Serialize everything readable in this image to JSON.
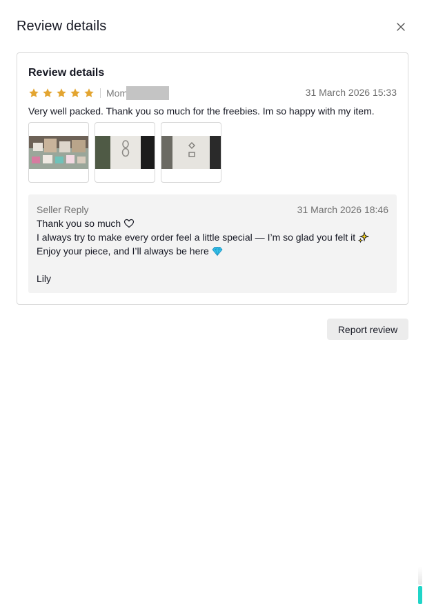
{
  "modal": {
    "title": "Review details",
    "close_icon": "close-icon"
  },
  "review": {
    "card_title": "Review details",
    "rating": 5,
    "max_rating": 5,
    "star_color": "#e3a531",
    "reviewer_name_visible": "Mom",
    "date": "31 March 2026 15:33",
    "text": "Very well packed. Thank you so much for the freebies. Im so happy with my item.",
    "photos": [
      {
        "name": "review-photo-1"
      },
      {
        "name": "review-photo-2"
      },
      {
        "name": "review-photo-3"
      }
    ]
  },
  "seller_reply": {
    "label": "Seller Reply",
    "date": "31 March 2026 18:46",
    "lines": [
      "Thank you so much",
      "I always try to make every order feel a little special — I’m so glad you felt it",
      "Enjoy your piece, and I’ll always be here",
      "",
      "Lily"
    ],
    "emojis": [
      "heart-outline-icon",
      "sparkles-icon",
      "gem-icon"
    ]
  },
  "actions": {
    "report_label": "Report review"
  },
  "colors": {
    "accent_teal": "#20d5c8",
    "reply_bg": "#f3f3f3",
    "button_bg": "#ececec"
  }
}
